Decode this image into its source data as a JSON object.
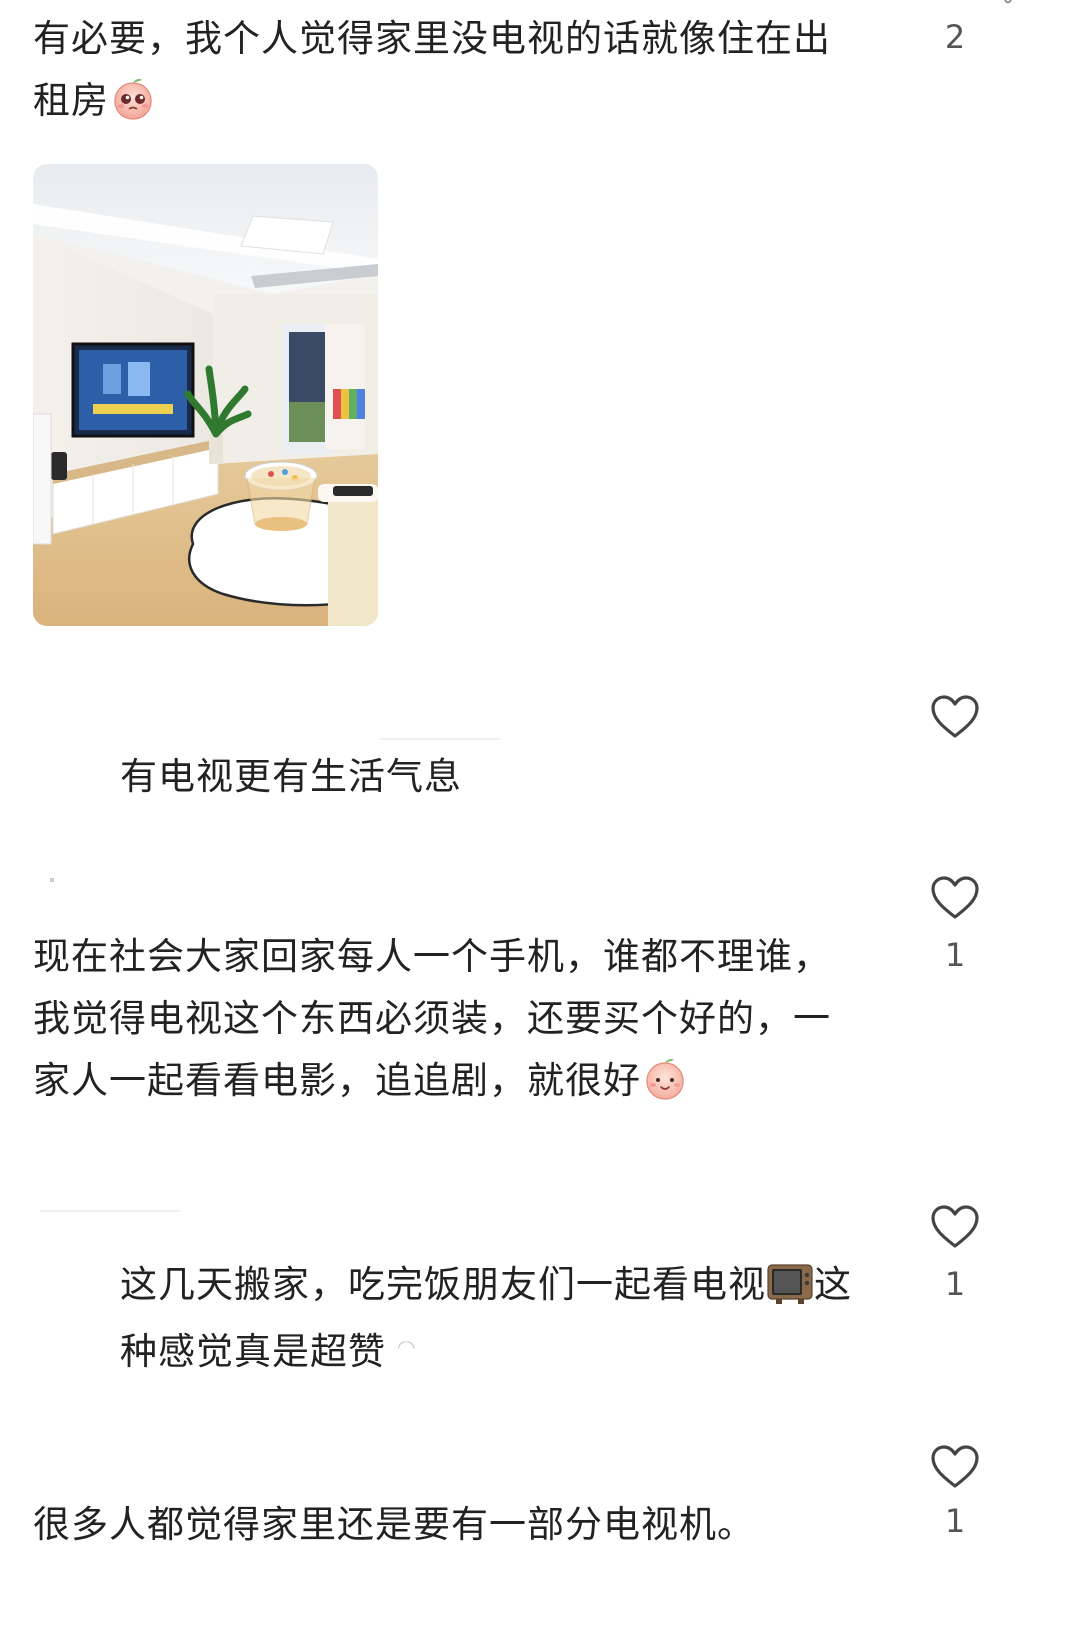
{
  "comments": [
    {
      "id": "c1",
      "text_line1": "有必要，我个人觉得家里没电视的话就像住在出",
      "text_line2": "租房",
      "like_count": "2",
      "emoji": "peach-pleading-emoji",
      "has_photo": true
    },
    {
      "id": "c2",
      "text": "有电视更有生活气息",
      "like_count": "",
      "is_reply": true
    },
    {
      "id": "c3",
      "text_line1": "现在社会大家回家每人一个手机，谁都不理谁，",
      "text_line2": "我觉得电视这个东西必须装，还要买个好的，一",
      "text_line3": "家人一起看看电影，追追剧，就很好",
      "like_count": "1",
      "emoji": "peach-smile-emoji"
    },
    {
      "id": "c4",
      "text_line1_a": "这几天搬家，吃完饭朋友们一起看电视",
      "text_line1_b": "这",
      "text_line2": "种感觉真是超赞",
      "like_count": "1",
      "emoji": "television-emoji",
      "is_reply": true
    },
    {
      "id": "c5",
      "text": "很多人都觉得家里还是要有一部分电视机。",
      "like_count": "1"
    }
  ],
  "colors": {
    "text": "#222222",
    "icon": "#555555",
    "background": "#ffffff"
  }
}
